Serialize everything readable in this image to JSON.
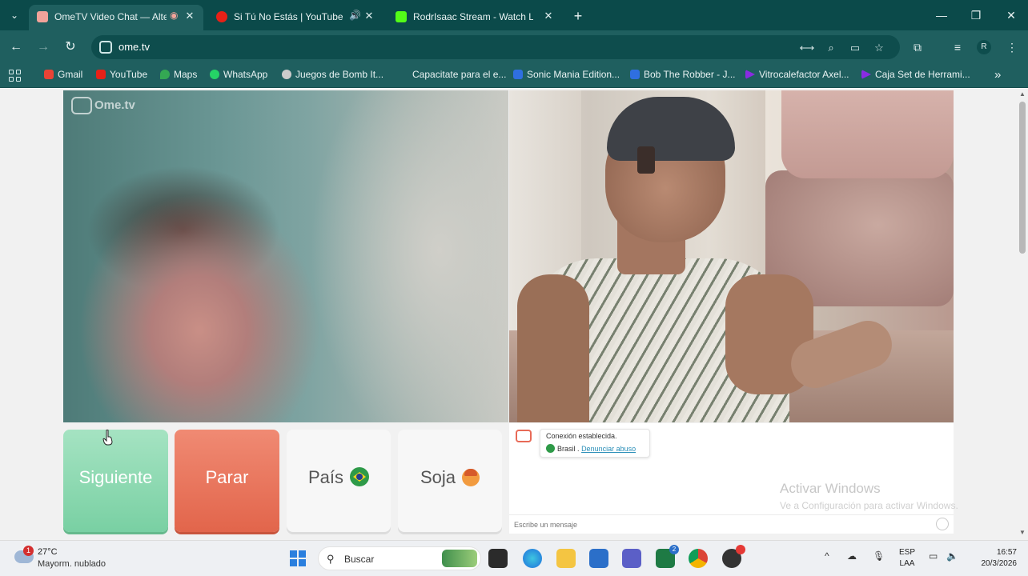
{
  "browser": {
    "tabs": [
      {
        "title": "OmeTV Video Chat — Alter",
        "active": true,
        "favicon_color": "#f2a39a"
      },
      {
        "title": "Si Tú No Estás | YouTube M",
        "active": false,
        "favicon_color": "#e62117"
      },
      {
        "title": "RodrIsaac Stream - Watch Live",
        "active": false,
        "favicon_color": "#53fc18"
      }
    ],
    "url": "ome.tv",
    "profile_initial": "R",
    "bookmarks": [
      {
        "label": "Gmail",
        "color": "#ea4335"
      },
      {
        "label": "YouTube",
        "color": "#e62117"
      },
      {
        "label": "Maps",
        "color": "#34a853"
      },
      {
        "label": "WhatsApp",
        "color": "#25d366"
      },
      {
        "label": "Juegos de Bomb It...",
        "color": "#cccccc"
      },
      {
        "label": "Capacitate para el e...",
        "color": "#1f5f5f"
      },
      {
        "label": "Sonic Mania Edition...",
        "color": "#2f6fe0"
      },
      {
        "label": "Bob The Robber - J...",
        "color": "#2f6fe0"
      },
      {
        "label": "Vitrocalefactor Axel...",
        "color": "#8a2be2"
      },
      {
        "label": "Caja Set de Herrami...",
        "color": "#8a2be2"
      }
    ]
  },
  "page": {
    "logo_text": "Ome.tv",
    "buttons": {
      "next": "Siguiente",
      "stop": "Parar",
      "country": "País",
      "gender": "Soja"
    },
    "chat": {
      "status": "Conexión establecida.",
      "country": "Brasil",
      "separator": ".",
      "report": "Denunciar abuso",
      "input_placeholder": "Escribe un mensaje"
    },
    "watermark": {
      "title": "Activar Windows",
      "subtitle": "Ve a Configuración para activar Windows."
    }
  },
  "taskbar": {
    "weather_temp": "27°C",
    "weather_desc": "Mayorm. nublado",
    "weather_badge": "1",
    "search_placeholder": "Buscar",
    "lang_line1": "ESP",
    "lang_line2": "LAA",
    "time": "16:57",
    "date": "20/3/2026",
    "apps": [
      {
        "name": "file-explorer-dark",
        "color": "#2b2b2b"
      },
      {
        "name": "edge",
        "color": "#1f8fdc"
      },
      {
        "name": "folder",
        "color": "#f4c542"
      },
      {
        "name": "store",
        "color": "#2b6fc9"
      },
      {
        "name": "teams",
        "color": "#5b5fc7"
      },
      {
        "name": "excel",
        "color": "#1e7a44",
        "badge": "2"
      },
      {
        "name": "chrome",
        "color": "#db4437"
      },
      {
        "name": "obs",
        "color": "#333333"
      }
    ]
  }
}
